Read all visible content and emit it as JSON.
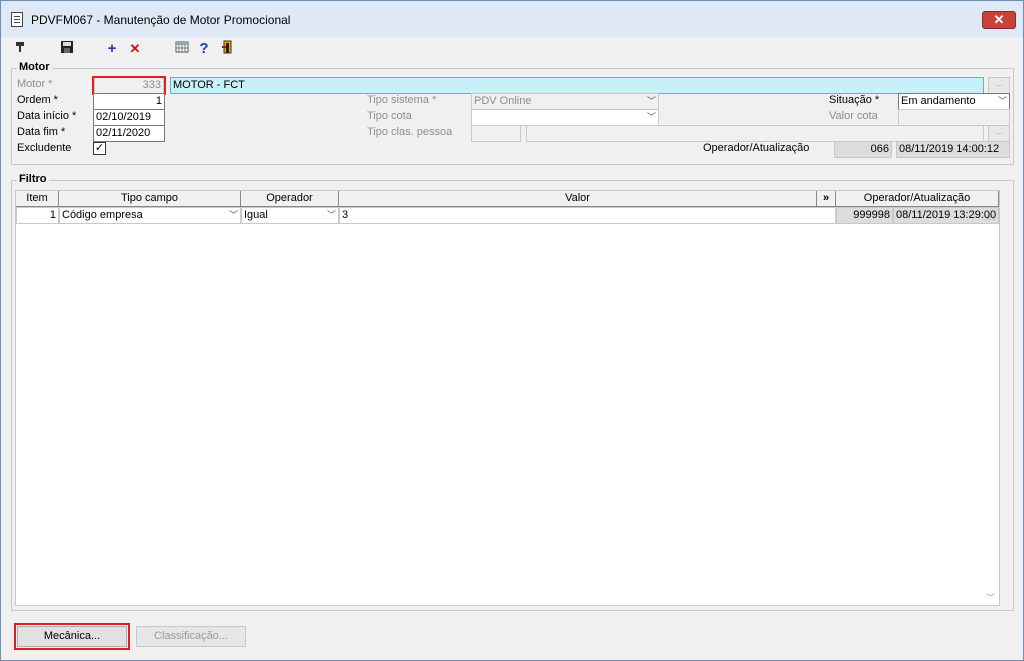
{
  "window": {
    "title": "PDVFM067 - Manutenção de Motor Promocional",
    "close_label": "✕"
  },
  "toolbar": {
    "icons": [
      "cursor-icon",
      "save-icon",
      "add-icon",
      "delete-icon",
      "calendar-grid-icon",
      "help-icon",
      "exit-icon"
    ],
    "add_glyph": "+",
    "delete_glyph": "✕",
    "help_glyph": "?"
  },
  "motor": {
    "group_title": "Motor",
    "motor_label": "Motor *",
    "motor_value": "333",
    "motor_name": "MOTOR - FCT",
    "ordem_label": "Ordem *",
    "ordem_value": "1",
    "data_inicio_label": "Data início *",
    "data_inicio_value": "02/10/2019",
    "data_fim_label": "Data fim *",
    "data_fim_value": "02/11/2020",
    "excludente_label": "Excludente",
    "excludente_checked": "✓",
    "tipo_sistema_label": "Tipo sistema *",
    "tipo_sistema_value": "PDV Online",
    "tipo_cota_label": "Tipo cota",
    "tipo_cota_value": "",
    "tipo_clas_label": "Tipo clas. pessoa",
    "situacao_label": "Situação *",
    "situacao_value": "Em andamento",
    "valor_cota_label": "Valor cota",
    "operador_label": "Operador/Atualização",
    "operador_value": "066",
    "atualizacao_value": "08/11/2019 14:00:12"
  },
  "filtro": {
    "group_title": "Filtro",
    "columns": [
      "Item",
      "Tipo campo",
      "Operador",
      "Valor",
      "»",
      "Operador/Atualização"
    ],
    "rows": [
      {
        "item": "1",
        "tipo_campo": "Código empresa",
        "operador": "Igual",
        "valor": "3",
        "op": "999998",
        "atualizacao": "08/11/2019 13:29:00"
      }
    ]
  },
  "buttons": {
    "mecanica": "Mecânica...",
    "classificacao": "Classificação..."
  },
  "colors": {
    "highlight": "#e02020",
    "name_field": "#c8f0f8"
  }
}
